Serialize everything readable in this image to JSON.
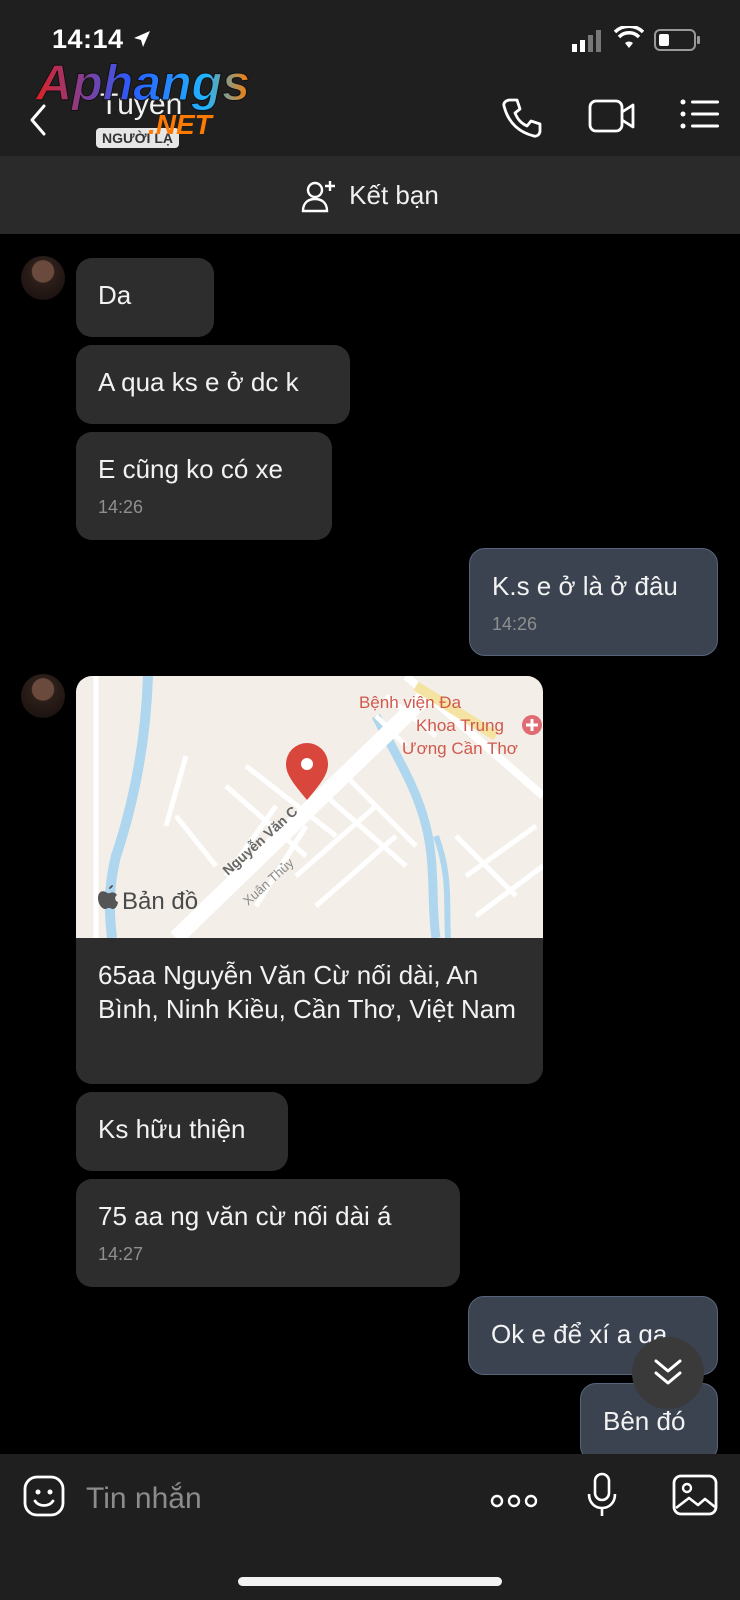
{
  "status_bar": {
    "time": "14:14"
  },
  "header": {
    "contact_name": "Tuyen",
    "badge": "NGƯỜI LẠ",
    "watermark_line1": "Aphangs",
    "watermark_line2": ".NET"
  },
  "friend_bar": {
    "label": "Kết bạn"
  },
  "messages": [
    {
      "dir": "in",
      "text": "Da"
    },
    {
      "dir": "in",
      "text": "A qua ks e ở dc k"
    },
    {
      "dir": "in",
      "text": "E cũng ko có xe",
      "time": "14:26"
    },
    {
      "dir": "out",
      "text": "K.s e ở là ở đâu",
      "time": "14:26"
    },
    {
      "dir": "in",
      "text": "Ks hữu thiện"
    },
    {
      "dir": "in",
      "text": "75 aa ng văn cừ nối dài á",
      "time": "14:27"
    },
    {
      "dir": "out",
      "text": "Ok e để xí a qa"
    },
    {
      "dir": "out",
      "text": "Bên đó"
    }
  ],
  "map_card": {
    "address": "65aa Nguyễn Văn Cừ nối dài, An Bình, Ninh Kiều, Cần Thơ, Việt Nam",
    "maps_label": "Bản đồ",
    "poi_line1": "Bệnh viện Đa",
    "poi_line2": "Khoa Trung",
    "poi_line3": "Ương Cần Thơ",
    "street_label": "Nguyễn Văn C",
    "street_label2": "Xuân Thủy"
  },
  "input_bar": {
    "placeholder": "Tin nhắn"
  },
  "colors": {
    "incoming": "#2d2d2d",
    "outgoing": "#3b4350",
    "pin": "#d9463b"
  }
}
